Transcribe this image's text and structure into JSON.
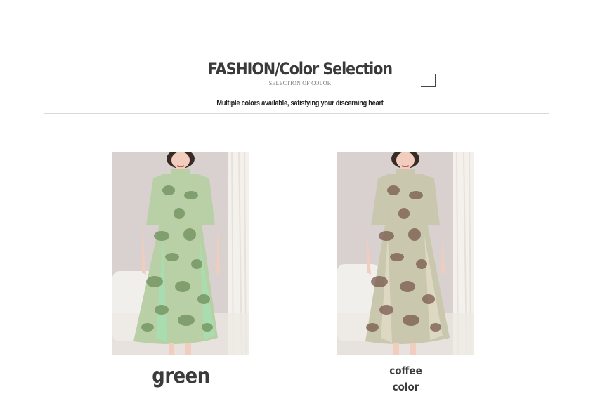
{
  "header": {
    "title": "FASHION/Color Selection",
    "subtitle": "SELECTION OF COLOR",
    "tagline": "Multiple colors available, satisfying your discerning heart"
  },
  "products": [
    {
      "label": "green",
      "dress_color": "#b9cfa6",
      "pattern_color": "#6f8f5c",
      "panel_color": "#a9dcae"
    },
    {
      "label_line1": "coffee",
      "label_line2": "color",
      "dress_color": "#c9c7ad",
      "pattern_color": "#7a5a4e",
      "panel_color": "#ddd8c2"
    }
  ],
  "colors": {
    "background": "#ffffff",
    "text": "#3a3a3a",
    "divider": "#d9d9d9",
    "wall": "#d9d0d0",
    "curtain": "#f4f1ec",
    "sofa": "#f1efeb"
  }
}
